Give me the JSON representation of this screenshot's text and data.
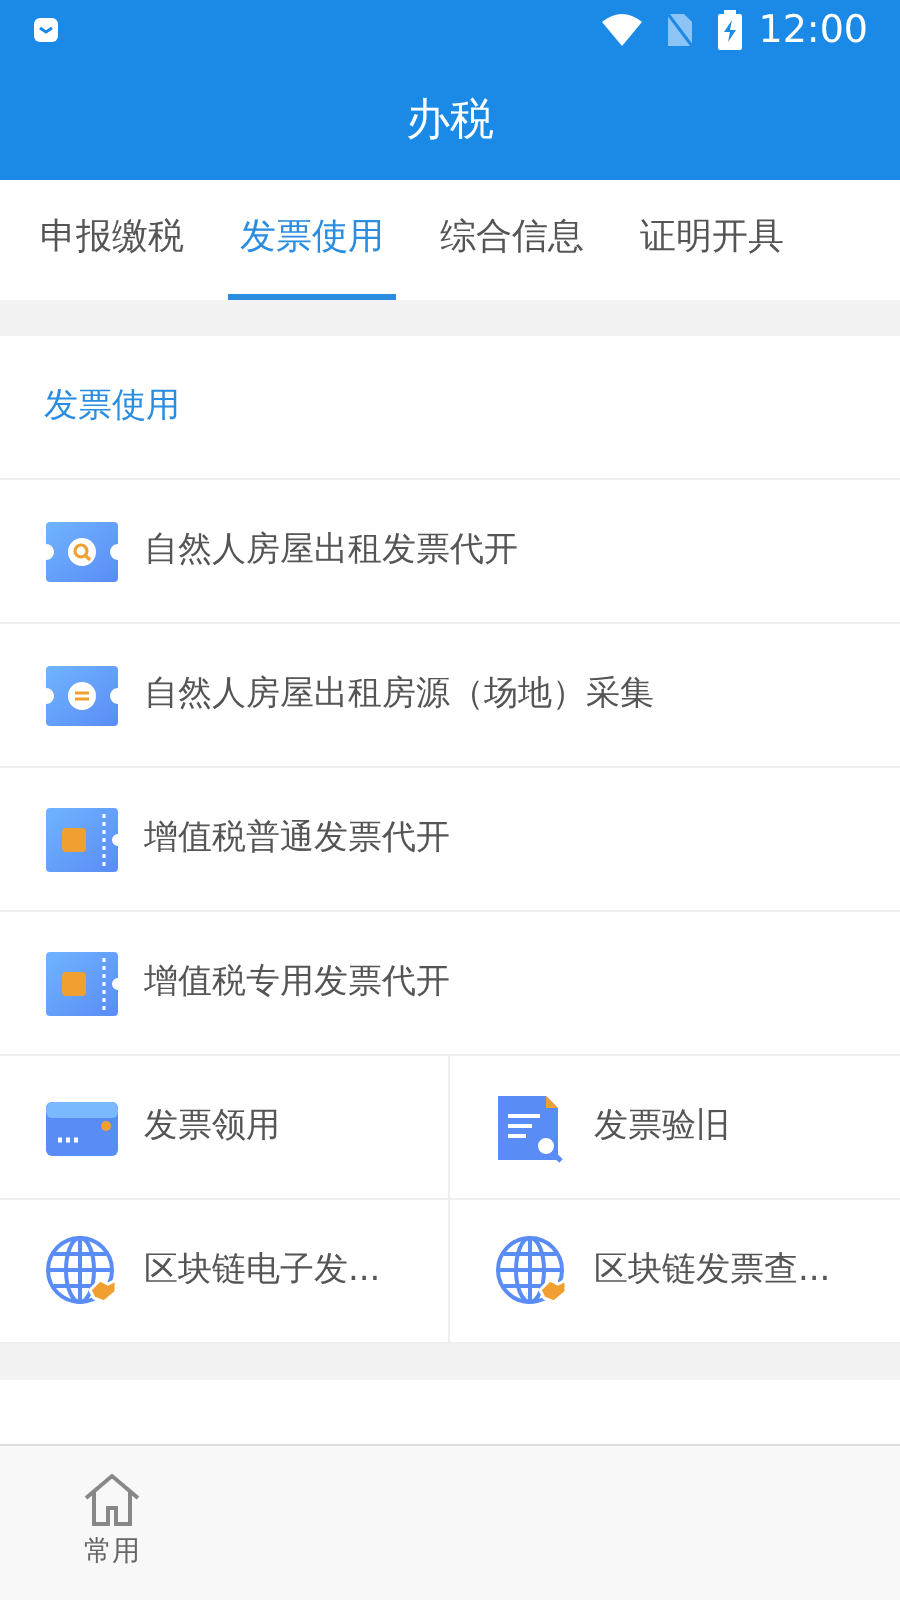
{
  "status_bar": {
    "time": "12:00"
  },
  "header": {
    "title": "办税"
  },
  "tabs": [
    {
      "label": "申报缴税",
      "selected": false
    },
    {
      "label": "发票使用",
      "selected": true
    },
    {
      "label": "综合信息",
      "selected": false
    },
    {
      "label": "证明开具",
      "selected": false
    }
  ],
  "section": {
    "title": "发票使用",
    "rows": [
      {
        "label": "自然人房屋出租发票代开"
      },
      {
        "label": "自然人房屋出租房源（场地）采集"
      },
      {
        "label": "增值税普通发票代开"
      },
      {
        "label": "增值税专用发票代开"
      }
    ],
    "grid": [
      {
        "label": "发票领用"
      },
      {
        "label": "发票验旧"
      },
      {
        "label": "区块链电子发..."
      },
      {
        "label": "区块链发票查..."
      }
    ]
  },
  "bottom_nav": [
    {
      "label": "常用"
    }
  ]
}
